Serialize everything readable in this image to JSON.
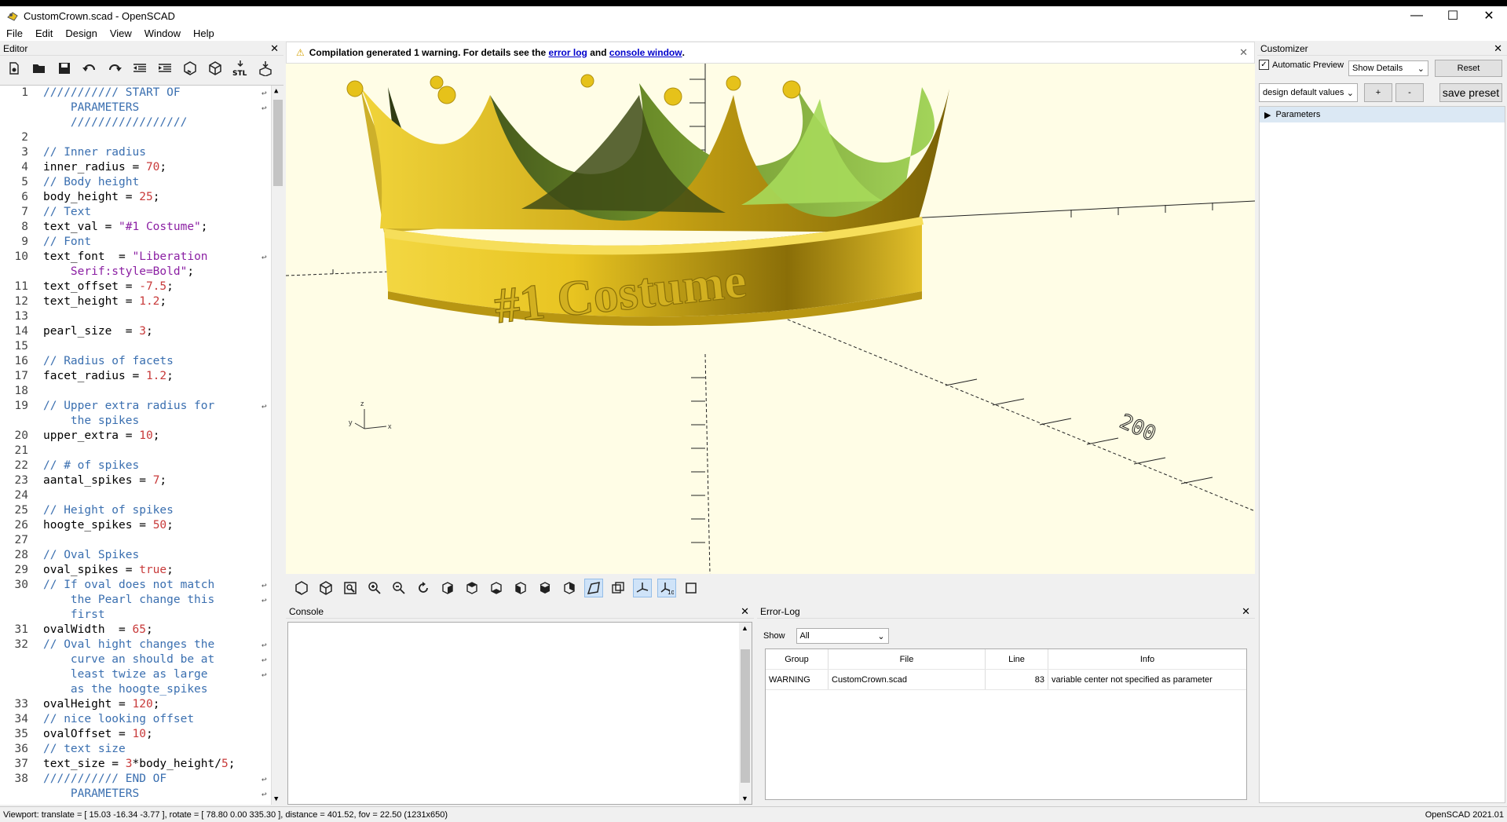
{
  "window": {
    "title": "CustomCrown.scad - OpenSCAD",
    "controls": [
      "—",
      "☐",
      "✕"
    ]
  },
  "menu": [
    "File",
    "Edit",
    "Design",
    "View",
    "Window",
    "Help"
  ],
  "editor": {
    "title": "Editor",
    "lines": [
      {
        "n": "1",
        "segs": [
          {
            "t": "/////////// START OF",
            "c": "cm"
          }
        ],
        "wrap": true
      },
      {
        "n": "",
        "segs": [
          {
            "t": "    PARAMETERS",
            "c": "cm"
          }
        ],
        "wrap": true
      },
      {
        "n": "",
        "segs": [
          {
            "t": "    /////////////////",
            "c": "cm"
          }
        ]
      },
      {
        "n": "2",
        "segs": []
      },
      {
        "n": "3",
        "segs": [
          {
            "t": "// Inner radius",
            "c": "cm"
          }
        ]
      },
      {
        "n": "4",
        "segs": [
          {
            "t": "inner_radius = ",
            "c": ""
          },
          {
            "t": "70",
            "c": "num"
          },
          {
            "t": ";",
            "c": ""
          }
        ]
      },
      {
        "n": "5",
        "segs": [
          {
            "t": "// Body height",
            "c": "cm"
          }
        ]
      },
      {
        "n": "6",
        "segs": [
          {
            "t": "body_height = ",
            "c": ""
          },
          {
            "t": "25",
            "c": "num"
          },
          {
            "t": ";",
            "c": ""
          }
        ]
      },
      {
        "n": "7",
        "segs": [
          {
            "t": "// Text",
            "c": "cm"
          }
        ]
      },
      {
        "n": "8",
        "segs": [
          {
            "t": "text_val = ",
            "c": ""
          },
          {
            "t": "\"#1 Costume\"",
            "c": "str"
          },
          {
            "t": ";",
            "c": ""
          }
        ]
      },
      {
        "n": "9",
        "segs": [
          {
            "t": "// Font",
            "c": "cm"
          }
        ]
      },
      {
        "n": "10",
        "segs": [
          {
            "t": "text_font  = ",
            "c": ""
          },
          {
            "t": "\"Liberation",
            "c": "str"
          }
        ],
        "wrap": true
      },
      {
        "n": "",
        "segs": [
          {
            "t": "    Serif:style=Bold\"",
            "c": "str"
          },
          {
            "t": ";",
            "c": ""
          }
        ]
      },
      {
        "n": "11",
        "segs": [
          {
            "t": "text_offset = ",
            "c": ""
          },
          {
            "t": "-7.5",
            "c": "num"
          },
          {
            "t": ";",
            "c": ""
          }
        ]
      },
      {
        "n": "12",
        "segs": [
          {
            "t": "text_height = ",
            "c": ""
          },
          {
            "t": "1.2",
            "c": "num"
          },
          {
            "t": ";",
            "c": ""
          }
        ]
      },
      {
        "n": "13",
        "segs": []
      },
      {
        "n": "14",
        "segs": [
          {
            "t": "pearl_size  = ",
            "c": ""
          },
          {
            "t": "3",
            "c": "num"
          },
          {
            "t": ";",
            "c": ""
          }
        ]
      },
      {
        "n": "15",
        "segs": []
      },
      {
        "n": "16",
        "segs": [
          {
            "t": "// Radius of facets",
            "c": "cm"
          }
        ]
      },
      {
        "n": "17",
        "segs": [
          {
            "t": "facet_radius = ",
            "c": ""
          },
          {
            "t": "1.2",
            "c": "num"
          },
          {
            "t": ";",
            "c": ""
          }
        ]
      },
      {
        "n": "18",
        "segs": []
      },
      {
        "n": "19",
        "segs": [
          {
            "t": "// Upper extra radius for",
            "c": "cm"
          }
        ],
        "wrap": true
      },
      {
        "n": "",
        "segs": [
          {
            "t": "    the spikes",
            "c": "cm"
          }
        ]
      },
      {
        "n": "20",
        "segs": [
          {
            "t": "upper_extra = ",
            "c": ""
          },
          {
            "t": "10",
            "c": "num"
          },
          {
            "t": ";",
            "c": ""
          }
        ]
      },
      {
        "n": "21",
        "segs": []
      },
      {
        "n": "22",
        "segs": [
          {
            "t": "// # of spikes",
            "c": "cm"
          }
        ]
      },
      {
        "n": "23",
        "segs": [
          {
            "t": "aantal_spikes = ",
            "c": ""
          },
          {
            "t": "7",
            "c": "num"
          },
          {
            "t": ";",
            "c": ""
          }
        ]
      },
      {
        "n": "24",
        "segs": []
      },
      {
        "n": "25",
        "segs": [
          {
            "t": "// Height of spikes",
            "c": "cm"
          }
        ]
      },
      {
        "n": "26",
        "segs": [
          {
            "t": "hoogte_spikes = ",
            "c": ""
          },
          {
            "t": "50",
            "c": "num"
          },
          {
            "t": ";",
            "c": ""
          }
        ]
      },
      {
        "n": "27",
        "segs": []
      },
      {
        "n": "28",
        "segs": [
          {
            "t": "// Oval Spikes",
            "c": "cm"
          }
        ]
      },
      {
        "n": "29",
        "segs": [
          {
            "t": "oval_spikes = ",
            "c": ""
          },
          {
            "t": "true",
            "c": "num"
          },
          {
            "t": ";",
            "c": ""
          }
        ]
      },
      {
        "n": "30",
        "segs": [
          {
            "t": "// If oval does not match",
            "c": "cm"
          }
        ],
        "wrap": true
      },
      {
        "n": "",
        "segs": [
          {
            "t": "    the Pearl change this",
            "c": "cm"
          }
        ],
        "wrap": true
      },
      {
        "n": "",
        "segs": [
          {
            "t": "    first",
            "c": "cm"
          }
        ]
      },
      {
        "n": "31",
        "segs": [
          {
            "t": "ovalWidth  = ",
            "c": ""
          },
          {
            "t": "65",
            "c": "num"
          },
          {
            "t": ";",
            "c": ""
          }
        ]
      },
      {
        "n": "32",
        "segs": [
          {
            "t": "// Oval hight changes the",
            "c": "cm"
          }
        ],
        "wrap": true
      },
      {
        "n": "",
        "segs": [
          {
            "t": "    curve an should be at",
            "c": "cm"
          }
        ],
        "wrap": true
      },
      {
        "n": "",
        "segs": [
          {
            "t": "    least twize as large",
            "c": "cm"
          }
        ],
        "wrap": true
      },
      {
        "n": "",
        "segs": [
          {
            "t": "    as the hoogte_spikes",
            "c": "cm"
          }
        ]
      },
      {
        "n": "33",
        "segs": [
          {
            "t": "ovalHeight = ",
            "c": ""
          },
          {
            "t": "120",
            "c": "num"
          },
          {
            "t": ";",
            "c": ""
          }
        ]
      },
      {
        "n": "34",
        "segs": [
          {
            "t": "// nice looking offset",
            "c": "cm"
          }
        ]
      },
      {
        "n": "35",
        "segs": [
          {
            "t": "ovalOffset = ",
            "c": ""
          },
          {
            "t": "10",
            "c": "num"
          },
          {
            "t": ";",
            "c": ""
          }
        ]
      },
      {
        "n": "36",
        "segs": [
          {
            "t": "// text size",
            "c": "cm"
          }
        ]
      },
      {
        "n": "37",
        "segs": [
          {
            "t": "text_size = ",
            "c": ""
          },
          {
            "t": "3",
            "c": "num"
          },
          {
            "t": "*body_height/",
            "c": ""
          },
          {
            "t": "5",
            "c": "num"
          },
          {
            "t": ";",
            "c": ""
          }
        ]
      },
      {
        "n": "38",
        "segs": [
          {
            "t": "/////////// END OF",
            "c": "cm"
          }
        ],
        "wrap": true
      },
      {
        "n": "",
        "segs": [
          {
            "t": "    PARAMETERS",
            "c": "cm"
          }
        ],
        "wrap": true
      }
    ]
  },
  "warning": {
    "prefix": "Compilation generated 1 warning. For details see the",
    "link1": "error log",
    "mid": "and",
    "link2": "console window",
    "suffix": "."
  },
  "viewport": {
    "crown_text": "#1 Costume",
    "axis_label": "200",
    "axes": {
      "x": "x",
      "y": "y",
      "z": "z"
    }
  },
  "console": {
    "title": "Console"
  },
  "errorlog": {
    "title": "Error-Log",
    "show_label": "Show",
    "show_value": "All",
    "columns": [
      "Group",
      "File",
      "Line",
      "Info"
    ],
    "rows": [
      {
        "group": "WARNING",
        "file": "CustomCrown.scad",
        "line": "83",
        "info": "variable center not specified as parameter"
      }
    ]
  },
  "customizer": {
    "title": "Customizer",
    "auto_preview": "Automatic Preview",
    "details": "Show Details",
    "reset": "Reset",
    "preset": "design default values",
    "plus": "+",
    "minus": "-",
    "save": "save preset",
    "tree_item": "Parameters"
  },
  "statusbar": {
    "left": "Viewport: translate = [ 15.03 -16.34 -3.77 ], rotate = [ 78.80 0.00 335.30 ], distance = 401.52, fov = 22.50 (1231x650)",
    "right": "OpenSCAD 2021.01"
  },
  "colors": {
    "viewport_bg": "#fffde6",
    "crown_gold": "#e6c21a",
    "crown_green": "#9bcf50",
    "link": "#0000cc"
  }
}
